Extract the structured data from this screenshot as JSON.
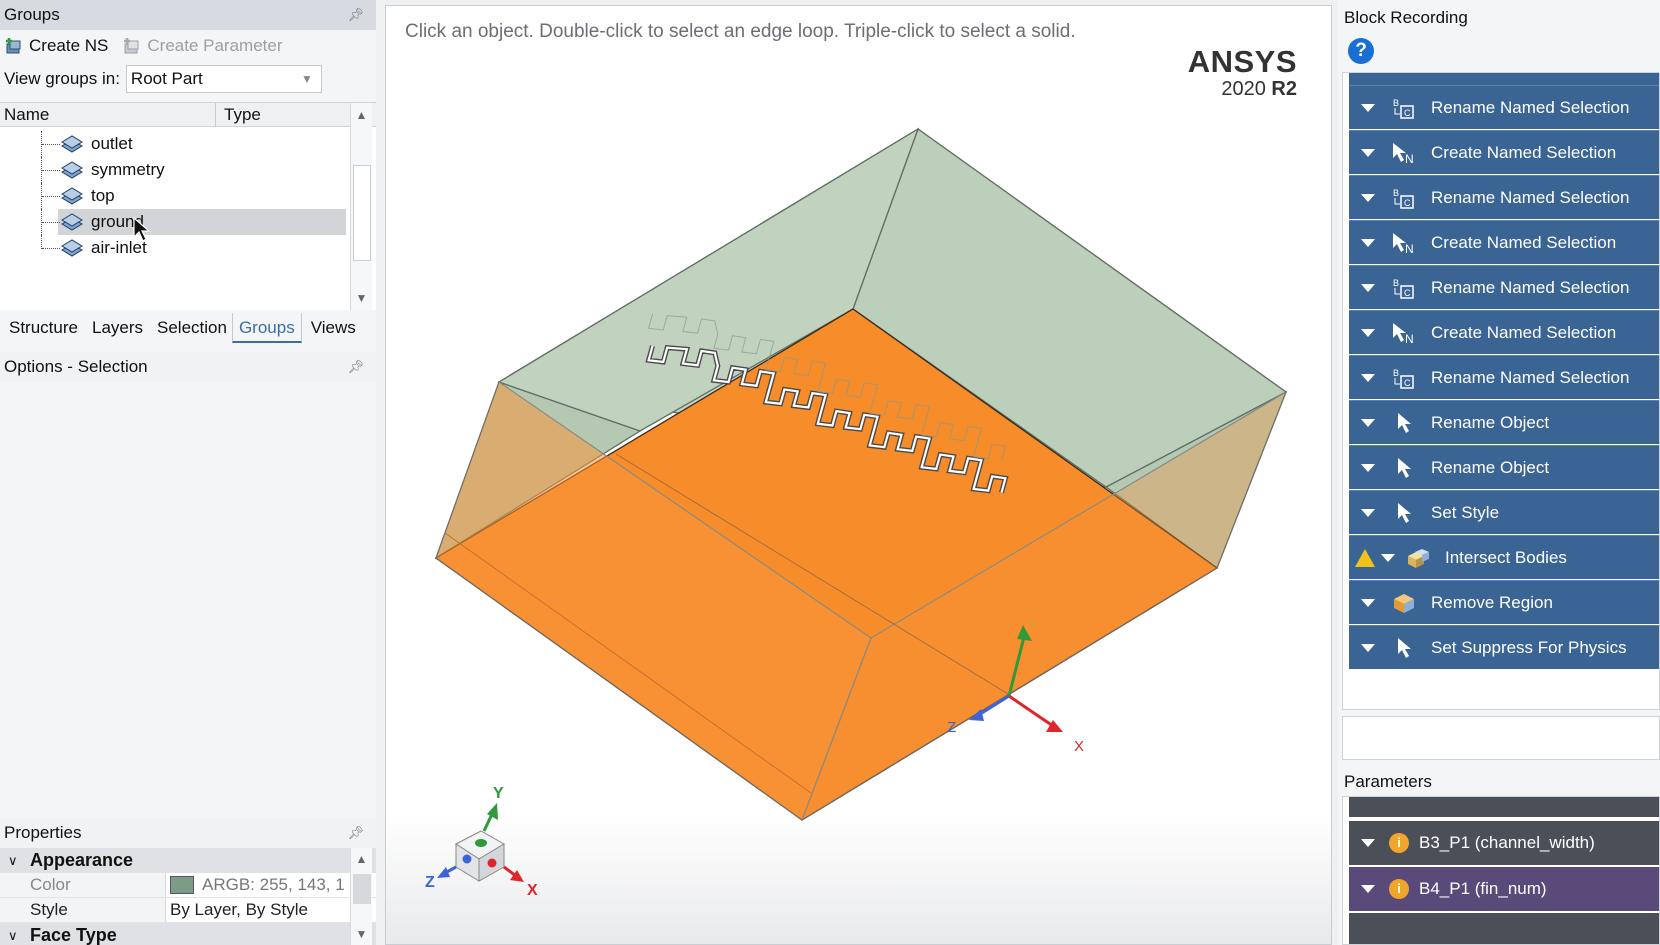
{
  "groups_panel": {
    "title": "Groups",
    "toolbar": {
      "create_ns": "Create NS",
      "create_parameter": "Create Parameter"
    },
    "view_groups_label": "View groups in:",
    "view_groups_value": "Root Part",
    "columns": {
      "name": "Name",
      "type": "Type"
    },
    "items": [
      {
        "label": "outlet",
        "selected": false
      },
      {
        "label": "symmetry",
        "selected": false
      },
      {
        "label": "top",
        "selected": false
      },
      {
        "label": "ground",
        "selected": true
      },
      {
        "label": "air-inlet",
        "selected": false
      }
    ]
  },
  "tabs": [
    {
      "label": "Structure",
      "active": false
    },
    {
      "label": "Layers",
      "active": false
    },
    {
      "label": "Selection",
      "active": false
    },
    {
      "label": "Groups",
      "active": true
    },
    {
      "label": "Views",
      "active": false
    }
  ],
  "options_panel": {
    "title": "Options - Selection"
  },
  "properties": {
    "title": "Properties",
    "categories": {
      "appearance": "Appearance",
      "face_type": "Face Type"
    },
    "rows": {
      "color_key": "Color",
      "color_value": "ARGB: 255, 143, 1",
      "style_key": "Style",
      "style_value": "By Layer, By Style"
    },
    "swatch_color": "#7d9c88"
  },
  "viewport": {
    "hint": "Click an object. Double-click to select an edge loop. Triple-click to select a solid.",
    "brand_name": "ANSYS",
    "version_year": "2020",
    "version_release": "R2",
    "triad_labels": {
      "x": "X",
      "y": "Y",
      "z": "Z"
    },
    "colors": {
      "enclosure_fill": "#b9cdb7",
      "ground_fill": "#f68c2a",
      "axis_x": "#e0262b",
      "axis_y": "#2e9a3a",
      "axis_z": "#3e63d8"
    }
  },
  "block_recording": {
    "title": "Block Recording",
    "blocks": [
      {
        "label": "Rename Named Selection",
        "icon": "rename-icon",
        "warning": false
      },
      {
        "label": "Create Named Selection",
        "icon": "create-ns-icon",
        "warning": false
      },
      {
        "label": "Rename Named Selection",
        "icon": "rename-icon",
        "warning": false
      },
      {
        "label": "Create Named Selection",
        "icon": "create-ns-icon",
        "warning": false
      },
      {
        "label": "Rename Named Selection",
        "icon": "rename-icon",
        "warning": false
      },
      {
        "label": "Create Named Selection",
        "icon": "create-ns-icon",
        "warning": false
      },
      {
        "label": "Rename Named Selection",
        "icon": "rename-icon",
        "warning": false
      },
      {
        "label": "Rename Object",
        "icon": "pointer-icon",
        "warning": false
      },
      {
        "label": "Rename Object",
        "icon": "pointer-icon",
        "warning": false
      },
      {
        "label": "Set Style",
        "icon": "pointer-icon",
        "warning": false
      },
      {
        "label": "Intersect Bodies",
        "icon": "intersect-icon",
        "warning": true
      },
      {
        "label": "Remove Region",
        "icon": "remove-region-icon",
        "warning": false
      },
      {
        "label": "Set Suppress For Physics",
        "icon": "pointer-icon",
        "warning": false
      }
    ],
    "block_color": "#3a6493"
  },
  "parameters": {
    "title": "Parameters",
    "items": [
      {
        "label": "B3_P1 (channel_width)",
        "color": "#4a4f58"
      },
      {
        "label": "B4_P1 (fin_num)",
        "color": "#5a4a7a"
      }
    ]
  }
}
